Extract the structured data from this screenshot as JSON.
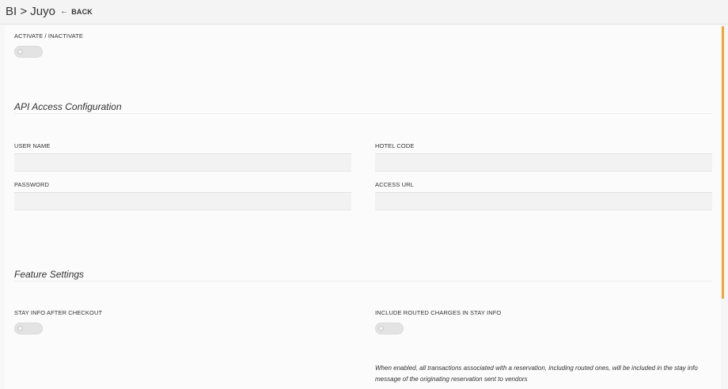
{
  "header": {
    "breadcrumb": "BI > Juyo",
    "back_label": "BACK"
  },
  "activate": {
    "label": "ACTIVATE / INACTIVATE",
    "enabled": false
  },
  "api_section": {
    "title": "API Access Configuration",
    "user_name": {
      "label": "USER NAME",
      "value": "",
      "placeholder": ""
    },
    "hotel_code": {
      "label": "HOTEL CODE",
      "value": "",
      "placeholder": ""
    },
    "password": {
      "label": "PASSWORD",
      "value": "",
      "placeholder": ""
    },
    "access_url": {
      "label": "ACCESS URL",
      "value": "",
      "placeholder": ""
    }
  },
  "feature_section": {
    "title": "Feature Settings",
    "stay_info": {
      "label": "STAY INFO AFTER CHECKOUT",
      "enabled": false
    },
    "routed_charges": {
      "label": "INCLUDE ROUTED CHARGES IN STAY INFO",
      "enabled": false
    },
    "routed_charges_help": "When enabled, all transactions associated with a reservation, including routed ones, will be included in the stay info message of the originating reservation sent to vendors"
  },
  "colors": {
    "scroll_accent": "#f2a534"
  }
}
